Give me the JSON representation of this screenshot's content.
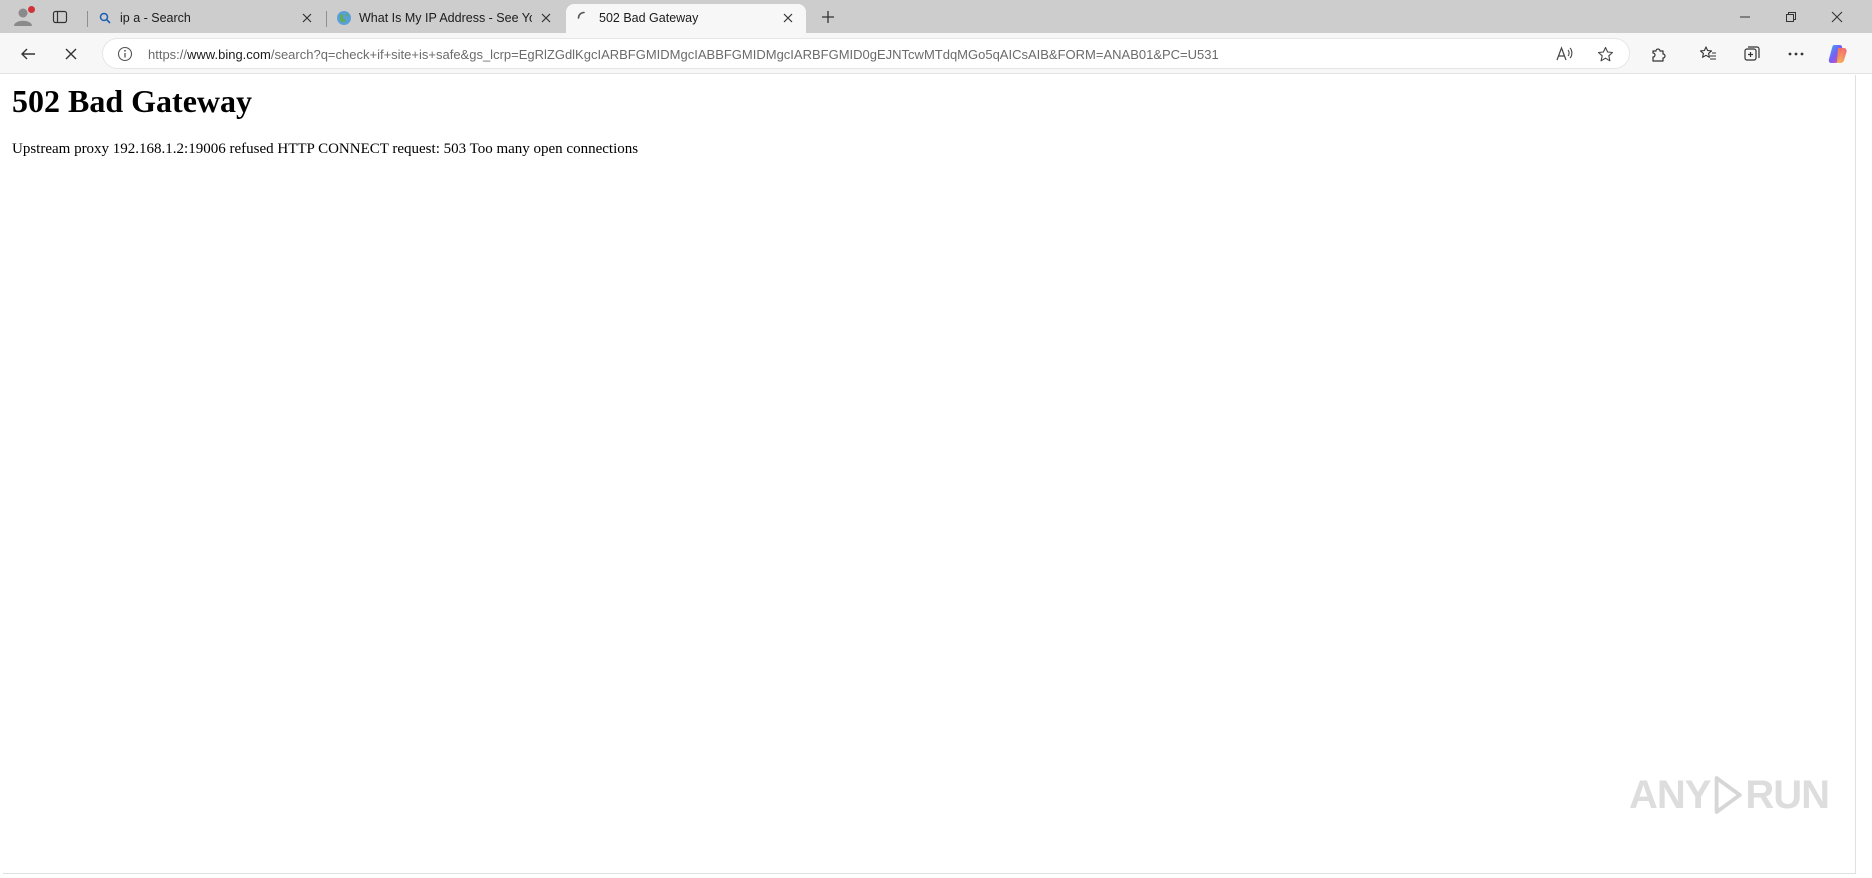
{
  "browser": {
    "tabs": [
      {
        "title": "ip a - Search",
        "favicon": "search-icon",
        "active": false
      },
      {
        "title": "What Is My IP Address - See Your",
        "favicon": "globe-icon",
        "active": false
      },
      {
        "title": "502 Bad Gateway",
        "favicon": "loading-spinner-icon",
        "active": true
      }
    ],
    "address_bar": {
      "scheme": "https://",
      "host": "www.bing.com",
      "path": "/search?q=check+if+site+is+safe&gs_lcrp=EgRlZGdlKgcIARBFGMIDMgcIABBFGMIDMgcIARBFGMID0gEJNTcwMTdqMGo5qAICsAIB&FORM=ANAB01&PC=U531"
    },
    "colors": {
      "tabstrip": "#cdcdcd",
      "toolbar": "#f7f7f7",
      "profile_badge": "#d13438"
    }
  },
  "page": {
    "heading": "502 Bad Gateway",
    "message": "Upstream proxy 192.168.1.2:19006 refused HTTP CONNECT request: 503 Too many open connections"
  },
  "watermark": {
    "left": "ANY",
    "right": "RUN"
  }
}
